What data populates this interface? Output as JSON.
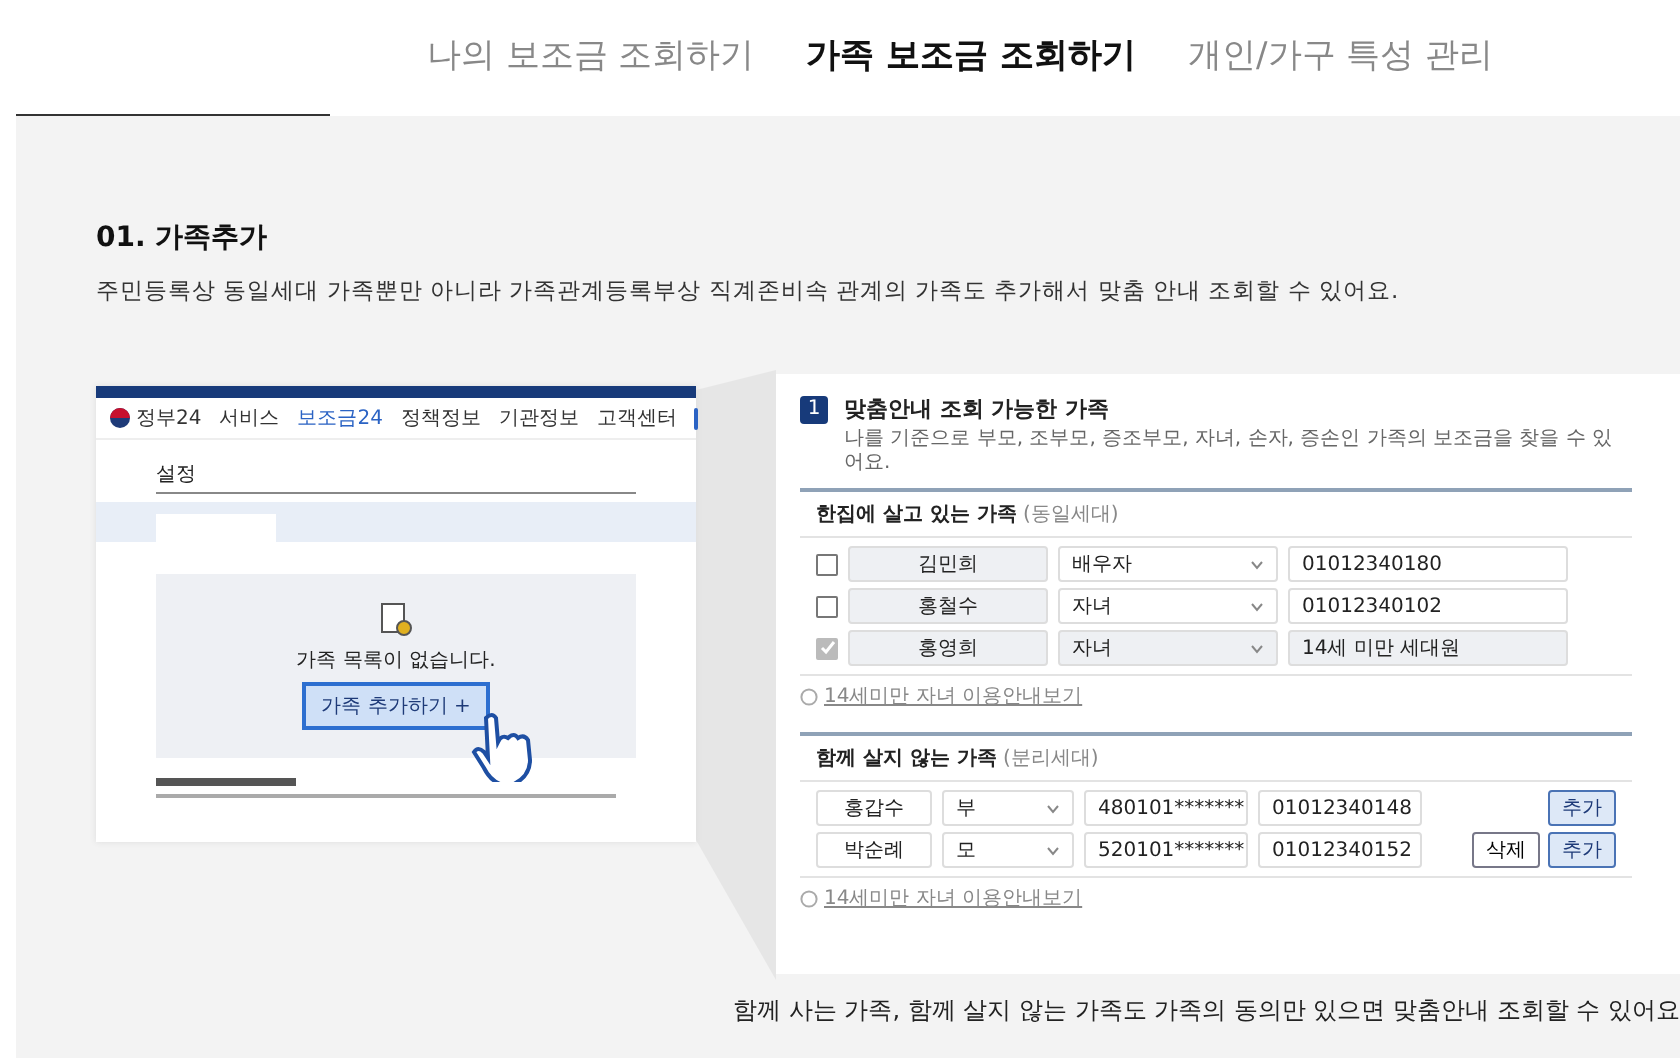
{
  "tabs": [
    {
      "label": "나의 보조금 조회하기",
      "selected": false
    },
    {
      "label": "가족 보조금 조회하기",
      "selected": true
    },
    {
      "label": "개인/가구 특성 관리",
      "selected": false
    }
  ],
  "section": {
    "title": "01. 가족추가",
    "description": "주민등록상 동일세대 가족뿐만 아니라 가족관계등록부상 직계존비속 관계의 가족도 추가해서 맞춤 안내 조회할 수 있어요."
  },
  "preview_left": {
    "logo": "정부24",
    "nav": [
      {
        "label": "서비스",
        "selected": false
      },
      {
        "label": "보조금24",
        "selected": true
      },
      {
        "label": "정책정보",
        "selected": false
      },
      {
        "label": "기관정보",
        "selected": false
      },
      {
        "label": "고객센터",
        "selected": false
      }
    ],
    "page_title": "설정",
    "empty_message": "가족 목록이 없습니다.",
    "add_button": "가족 추가하기 +"
  },
  "preview_right": {
    "step": "1",
    "title": "맞춤안내 조회 가능한 가족",
    "description": "나를 기준으로 부모, 조부모, 증조부모, 자녀, 손자, 증손인 가족의 보조금을 찾을 수 있어요.",
    "groups": [
      {
        "kind": "same",
        "title": "한집에 살고 있는 가족",
        "note": "(동일세대)",
        "link": "14세미만 자녀 이용안내보기",
        "rows": [
          {
            "name": "김민희",
            "relation": "배우자",
            "phone": "01012340180",
            "checked": false,
            "disabled": false
          },
          {
            "name": "홍철수",
            "relation": "자녀",
            "phone": "01012340102",
            "checked": false,
            "disabled": false
          },
          {
            "name": "홍영희",
            "relation": "자녀",
            "phone": "14세 미만 세대원",
            "checked": true,
            "disabled": true
          }
        ]
      },
      {
        "kind": "separate",
        "title": "함께 살지 않는 가족",
        "note": "(분리세대)",
        "link": "14세미만 자녀 이용안내보기",
        "rows": [
          {
            "name": "홍갑수",
            "relation": "부",
            "id_number": "480101*******",
            "phone": "01012340148",
            "buttons": [
              {
                "label": "추가",
                "kind": "primary"
              }
            ]
          },
          {
            "name": "박순례",
            "relation": "모",
            "id_number": "520101*******",
            "phone": "01012340152",
            "buttons": [
              {
                "label": "삭제",
                "kind": "secondary"
              },
              {
                "label": "추가",
                "kind": "primary"
              }
            ]
          }
        ]
      }
    ]
  },
  "caption": "함께 사는 가족, 함께 살지 않는 가족도 가족의 동의만 있으면 맞춤안내 조회할 수 있어요"
}
